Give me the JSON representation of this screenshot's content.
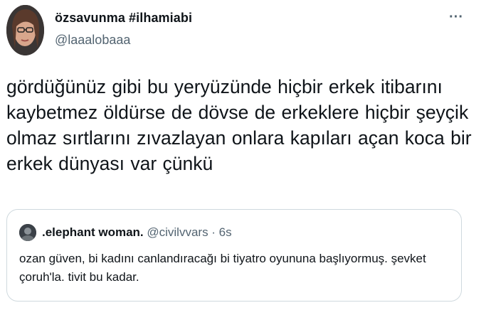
{
  "tweet": {
    "author": {
      "display_name": "özsavunma #ilhamiabi",
      "handle": "@laaalobaaa"
    },
    "more_icon": "more-horizontal-icon",
    "more_label": "···",
    "text_lines": [
      "gördüğünüz gibi bu yeryüzünde hiçbir erkek itibarını",
      "kaybetmez öldürse de dövse de erkeklere hiçbir şeyçik",
      "olmaz sırtlarını zıvazlayan onlara kapıları açan koca bir",
      "erkek dünyası var çünkü"
    ],
    "quoted": {
      "display_name": ".elephant woman.",
      "meta": "@civilvvars · 6s",
      "text_lines": [
        "ozan güven, bi kadını canlandıracağı bi tiyatro oyununa başlıyormuş. şevket",
        "çoruh'la. tivit bu kadar."
      ]
    }
  },
  "colors": {
    "text": "#0f1419",
    "secondary": "#536471",
    "border": "#cfd9de"
  }
}
